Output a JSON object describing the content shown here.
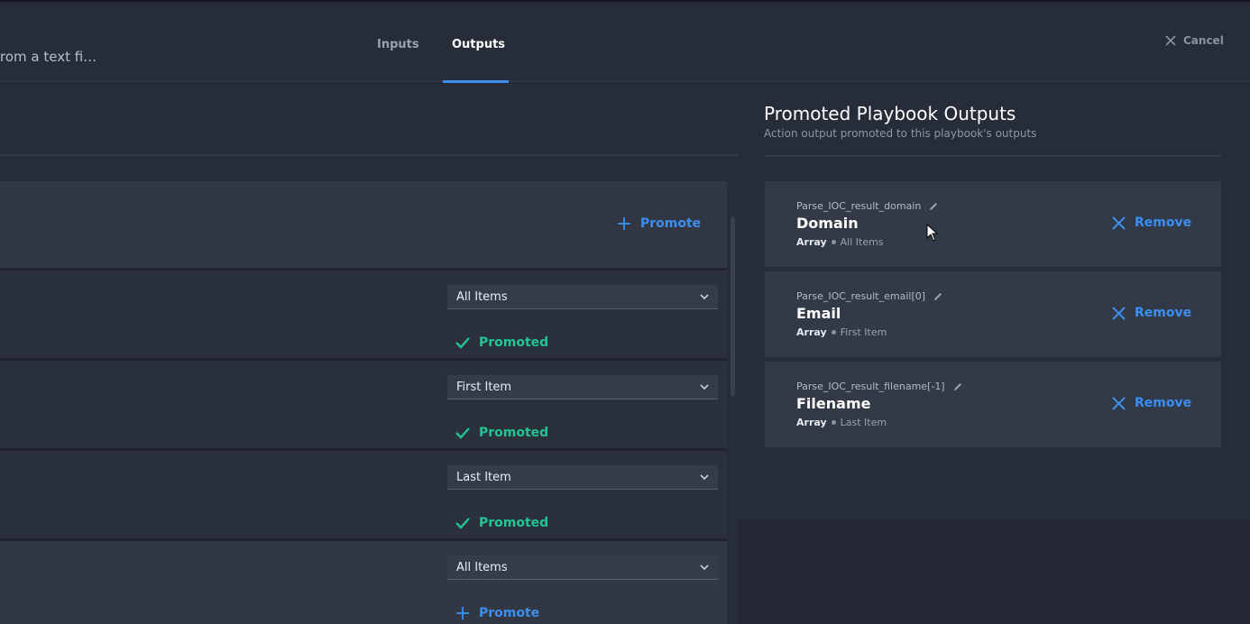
{
  "header": {
    "title_fragment": "rom a text fi…",
    "tabs": [
      {
        "label": "Inputs"
      },
      {
        "label": "Outputs"
      }
    ],
    "cancel_label": "Cancel"
  },
  "left": {
    "promote_label": "Promote",
    "rows": [
      {
        "select_value": "All Items",
        "status": "Promoted"
      },
      {
        "select_value": "First Item",
        "status": "Promoted"
      },
      {
        "select_value": "Last Item",
        "status": "Promoted"
      },
      {
        "select_value": "All Items",
        "status": "Promote"
      }
    ]
  },
  "panel": {
    "title": "Promoted Playbook Outputs",
    "subtitle": "Action output promoted to this playbook's outputs",
    "remove_label": "Remove",
    "items": [
      {
        "path": "Parse_IOC_result_domain",
        "name": "Domain",
        "type": "Array",
        "selection": "All Items"
      },
      {
        "path": "Parse_IOC_result_email[0]",
        "name": "Email",
        "type": "Array",
        "selection": "First Item"
      },
      {
        "path": "Parse_IOC_result_filename[-1]",
        "name": "Filename",
        "type": "Array",
        "selection": "Last Item"
      }
    ]
  },
  "colors": {
    "accent_blue": "#3c8ef0",
    "promoted_green": "#22c493",
    "background": "#242a36"
  },
  "icons": [
    "close-icon",
    "plus-icon",
    "chevron-down-icon",
    "check-icon",
    "pencil-icon",
    "cursor-icon"
  ]
}
